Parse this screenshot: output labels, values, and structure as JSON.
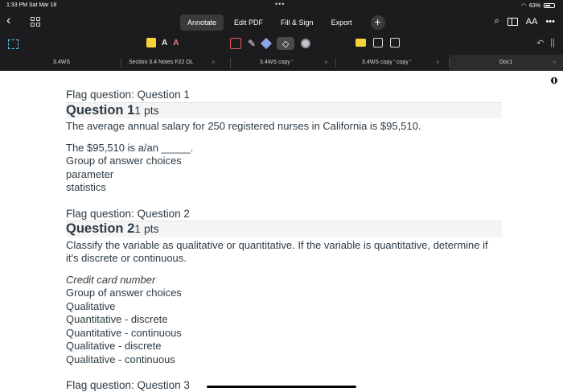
{
  "status_bar": {
    "time_date": "1:33 PM   Sat Mar 18",
    "dots": "•••",
    "battery": "63%",
    "battery_level": 0.63
  },
  "menu": {
    "back": "‹",
    "tabs": [
      {
        "label": "Annotate",
        "active": true
      },
      {
        "label": "Edit PDF",
        "active": false
      },
      {
        "label": "Fill & Sign",
        "active": false
      },
      {
        "label": "Export",
        "active": false
      }
    ],
    "add": "+",
    "text_size": "AA",
    "more": "•••"
  },
  "toolbar": {
    "text_a": "A",
    "strike_a": "A",
    "pen": "✎",
    "eraser": "◇",
    "undo": "↶",
    "pause": "||"
  },
  "tabs": [
    {
      "label": "3.4WS",
      "close": ""
    },
    {
      "label": "Section 3.4 Notes F22 OL",
      "close": "×"
    },
    {
      "label": "3.4WS copy '",
      "close": "×"
    },
    {
      "label": "3.4WS copy ' copy '",
      "close": "×"
    },
    {
      "label": "Doc1",
      "close": "×"
    }
  ],
  "page": {
    "q1": {
      "flag": "Flag question: Question 1",
      "title": "Question 1",
      "pts": "1 pts",
      "text": "The average annual salary for 250 registered nurses in California is $95,510.",
      "prompt": "The $95,510 is a/an _____.",
      "choices_label": "Group of answer choices",
      "choices": [
        "parameter",
        "statistics"
      ]
    },
    "q2": {
      "flag": "Flag question: Question 2",
      "title": "Question 2",
      "pts": "1 pts",
      "text": "Classify the variable as qualitative or quantitative.  If the variable is quantitative, determine if it's discrete or continuous.",
      "variable": "Credit card number",
      "choices_label": "Group of answer choices",
      "choices": [
        "Qualitative",
        "Quantitative - discrete",
        "Quantitative - continuous",
        "Qualitative - discrete",
        "Qualitative - continuous"
      ]
    },
    "q3": {
      "flag": "Flag question: Question 3"
    }
  }
}
